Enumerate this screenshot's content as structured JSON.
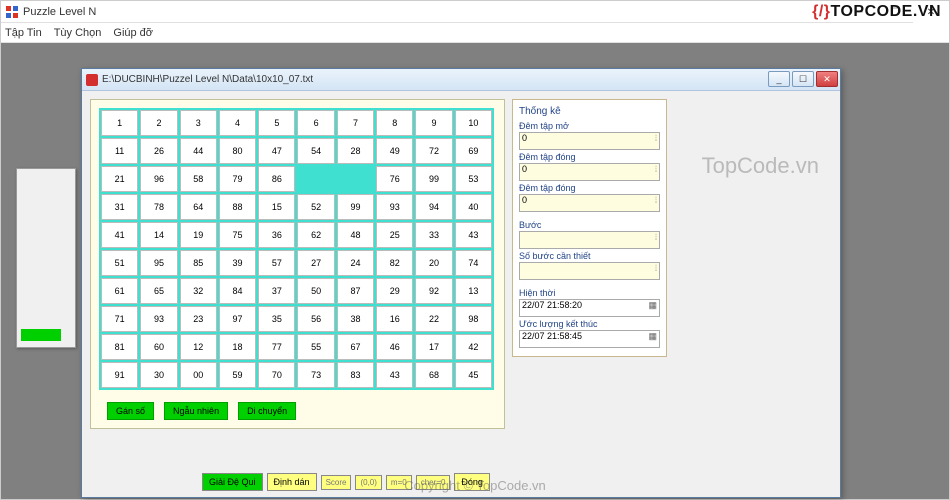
{
  "outer": {
    "title": "Puzzle Level N",
    "menu": [
      "Tập Tin",
      "Tùy Chọn",
      "Giúp đỡ"
    ]
  },
  "logo": {
    "brace": "{/}",
    "text": "TOPCODE.VN"
  },
  "watermark1": "TopCode.vn",
  "watermark2": "Copyright © TopCode.vn",
  "inner": {
    "title": "E:\\DUCBINH\\Puzzel Level N\\Data\\10x10_07.txt"
  },
  "grid": [
    [
      "1",
      "2",
      "3",
      "4",
      "5",
      "6",
      "7",
      "8",
      "9",
      "10"
    ],
    [
      "11",
      "26",
      "44",
      "80",
      "47",
      "54",
      "28",
      "49",
      "72",
      "69"
    ],
    [
      "21",
      "96",
      "58",
      "79",
      "86",
      "",
      "",
      "76",
      "99",
      "53"
    ],
    [
      "31",
      "78",
      "64",
      "88",
      "15",
      "52",
      "99",
      "93",
      "94",
      "40"
    ],
    [
      "41",
      "14",
      "19",
      "75",
      "36",
      "62",
      "48",
      "25",
      "33",
      "43"
    ],
    [
      "51",
      "95",
      "85",
      "39",
      "57",
      "27",
      "24",
      "82",
      "20",
      "74"
    ],
    [
      "61",
      "65",
      "32",
      "84",
      "37",
      "50",
      "87",
      "29",
      "92",
      "13"
    ],
    [
      "71",
      "93",
      "23",
      "97",
      "35",
      "56",
      "38",
      "16",
      "22",
      "98"
    ],
    [
      "81",
      "60",
      "12",
      "18",
      "77",
      "55",
      "67",
      "46",
      "17",
      "42"
    ],
    [
      "91",
      "30",
      "00",
      "59",
      "70",
      "73",
      "83",
      "43",
      "68",
      "45"
    ]
  ],
  "puzzle_buttons": {
    "b1": "Gán số",
    "b2": "Ngẫu nhiên",
    "b3": "Di chuyển"
  },
  "stats": {
    "title": "Thống kê",
    "f1": "Đêm tập mở",
    "v1": "0",
    "f2": "Đêm tập đóng",
    "v2": "0",
    "f3": "Đêm tập đóng",
    "v3": "0",
    "f4": "Bước",
    "v4": "",
    "f5": "Số bước cần thiết",
    "v5": "",
    "f6": "Hiện thời",
    "v6": "22/07 21:58:20",
    "f7": "Ước lượng kết thúc",
    "v7": "22/07 21:58:45"
  },
  "bottom": {
    "b1": "Giải Đệ Qui",
    "b2": "Định dán",
    "b3": "Score",
    "b4": "(0,0)",
    "b5": "m=0",
    "b6": "cher=0",
    "b7": "Đóng"
  }
}
